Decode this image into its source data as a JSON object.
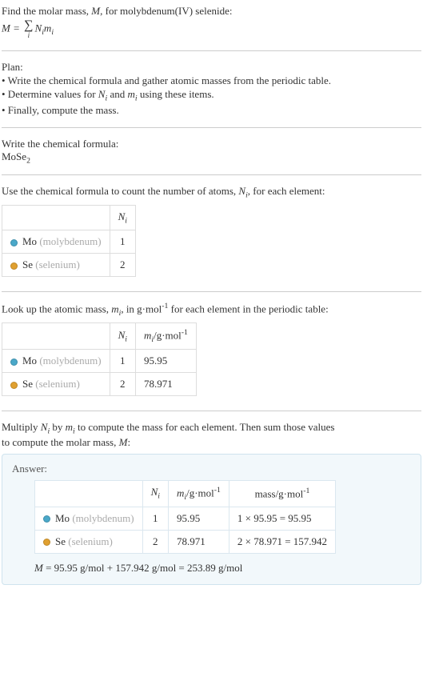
{
  "intro": {
    "line1_prefix": "Find the molar mass, ",
    "line1_var": "M",
    "line1_suffix": ", for molybdenum(IV) selenide:"
  },
  "formula": {
    "lhs": "M",
    "eq": " = ",
    "rhs1": "N",
    "rhs1_sub": "i",
    "rhs2": "m",
    "rhs2_sub": "i",
    "sigma_under": "i"
  },
  "plan": {
    "heading": "Plan:",
    "b1": "• Write the chemical formula and gather atomic masses from the periodic table.",
    "b2_pre": "• Determine values for ",
    "b2_n": "N",
    "b2_nsub": "i",
    "b2_mid": " and ",
    "b2_m": "m",
    "b2_msub": "i",
    "b2_post": " using these items.",
    "b3": "• Finally, compute the mass."
  },
  "chem": {
    "heading": "Write the chemical formula:",
    "formula_main": "MoSe",
    "formula_sub": "2"
  },
  "count": {
    "heading_pre": "Use the chemical formula to count the number of atoms, ",
    "heading_var": "N",
    "heading_sub": "i",
    "heading_post": ", for each element:",
    "col_n": "N",
    "col_n_sub": "i"
  },
  "elements": {
    "mo": {
      "sym": "Mo",
      "name": "(molybdenum)",
      "n": "1",
      "m": "95.95",
      "mass": "1 × 95.95 = 95.95"
    },
    "se": {
      "sym": "Se",
      "name": "(selenium)",
      "n": "2",
      "m": "78.971",
      "mass": "2 × 78.971 = 157.942"
    }
  },
  "lookup": {
    "heading_pre": "Look up the atomic mass, ",
    "heading_var": "m",
    "heading_sub": "i",
    "heading_mid": ", in g·mol",
    "heading_exp": "-1",
    "heading_post": " for each element in the periodic table:",
    "col_n": "N",
    "col_n_sub": "i",
    "col_m": "m",
    "col_m_sub": "i",
    "col_m_unit_pre": "/g·mol",
    "col_m_unit_exp": "-1"
  },
  "multiply": {
    "line_pre": "Multiply ",
    "n": "N",
    "n_sub": "i",
    "mid": " by ",
    "m": "m",
    "m_sub": "i",
    "line_post1": " to compute the mass for each element. Then sum those values",
    "line_post2": "to compute the molar mass, ",
    "var": "M",
    "colon": ":"
  },
  "answer": {
    "title": "Answer:",
    "col_n": "N",
    "col_n_sub": "i",
    "col_m": "m",
    "col_m_sub": "i",
    "col_m_unit_pre": "/g·mol",
    "col_m_unit_exp": "-1",
    "col_mass_pre": "mass/g·mol",
    "col_mass_exp": "-1",
    "result_lhs": "M",
    "result_rhs": " = 95.95 g/mol + 157.942 g/mol = 253.89 g/mol"
  }
}
